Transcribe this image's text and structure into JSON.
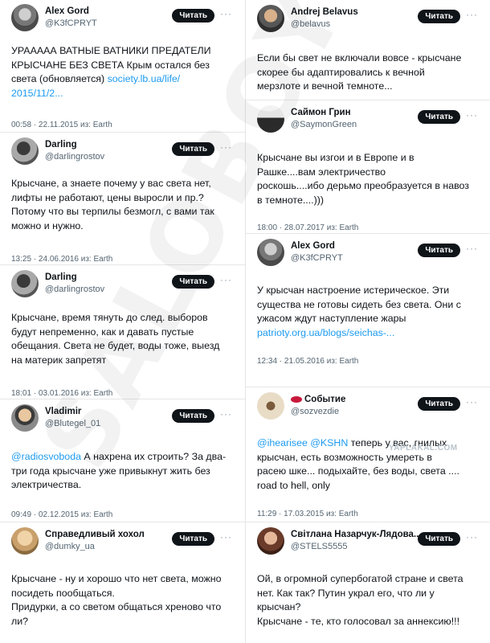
{
  "ui": {
    "follow_label": "Читать",
    "more_glyph": "···"
  },
  "watermark": "SALOBOY",
  "site_watermark": "YAPLAKAL.COM",
  "left": [
    {
      "name": "Alex Gord",
      "handle": "@K3fCPRYT",
      "lines": [
        [
          "УРААААА ВАТНЫЕ ВАТНИКИ ПРЕДАТЕЛИ"
        ],
        [
          "КРЫСЧАНЕ БЕЗ СВЕТА  Крым остался без"
        ],
        [
          "света (обновляется) ",
          "society.lb.ua/life/"
        ],
        [
          "",
          "2015/11/2..."
        ]
      ],
      "time": "00:58 · 22.11.2015 из: Earth"
    },
    {
      "name": "Darling",
      "handle": "@darlingrostov",
      "lines": [
        [
          "Крысчане, а знаете почему у вас света нет,"
        ],
        [
          "лифты не работают, цены выросли и пр.?"
        ],
        [
          "Потому что вы терпилы безмогл, с вами так"
        ],
        [
          "можно и нужно."
        ]
      ],
      "time": "13:25 · 24.06.2016 из: Earth"
    },
    {
      "name": "Darling",
      "handle": "@darlingrostov",
      "lines": [
        [
          "Крысчане, время тянуть до след. выборов"
        ],
        [
          "будут непременно, как и давать пустые"
        ],
        [
          "обещания. Света не будет, воды тоже, выезд"
        ],
        [
          "на материк запретят"
        ]
      ],
      "time": "18:01 · 03.01.2016 из: Earth"
    },
    {
      "name": "Vladimir",
      "handle": "@Blutegel_01",
      "lines": [
        [
          "",
          "@radiosvoboda",
          " А нахрена их строить? За два-"
        ],
        [
          "три года крысчане уже привыкнут жить без"
        ],
        [
          "электричества."
        ]
      ],
      "time": "09:49 · 02.12.2015 из: Earth"
    },
    {
      "name": "Справедливый хохол",
      "handle": "@dumky_ua",
      "lines": [
        [
          "Крысчане - ну и хорошо что нет света, можно"
        ],
        [
          "посидеть пообщаться."
        ],
        [
          "Придурки, а со светом общаться хреново что"
        ],
        [
          "ли?"
        ]
      ],
      "time": ""
    }
  ],
  "right": [
    {
      "name": "Andrej Belavus",
      "handle": "@belavus",
      "lines": [
        [
          "Если бы свет не включали вовсе - крысчане"
        ],
        [
          "скорее бы адаптировались к вечной"
        ],
        [
          "мерзлоте и вечной темноте..."
        ]
      ],
      "time": ""
    },
    {
      "name": "Саймон Грин",
      "handle": "@SaymonGreen",
      "lines": [
        [
          "Крысчане вы изгои и в Европе и в"
        ],
        [
          "            Рашке....вам электричество"
        ],
        [
          "роскошь....ибо дерьмо преобразуется в навоз"
        ],
        [
          "в темноте....)))"
        ]
      ],
      "time": "18:00 · 28.07.2017 из: Earth"
    },
    {
      "name": "Alex Gord",
      "handle": "@K3fCPRYT",
      "lines": [
        [
          "У крысчан настроение истерическое. Эти"
        ],
        [
          "существа не готовы сидеть без света. Они с"
        ],
        [
          "ужасом ждут наступление жары"
        ],
        [
          "",
          "patrioty.org.ua/blogs/seichas-..."
        ]
      ],
      "time": "12:34 · 21.05.2016 из: Earth"
    },
    {
      "name": "Событие",
      "handle": "@sozvezdie",
      "lines": [
        [
          "",
          "@ihearisee @KSHN",
          " теперь у вас, гнилых"
        ],
        [
          "крысчан, есть возможность умереть в"
        ],
        [
          "расею шке... подыхайте, без воды, света ...."
        ],
        [
          "road to hell, only"
        ]
      ],
      "time": "11:29 · 17.03.2015 из: Earth"
    },
    {
      "name": "Світлана Назарчук-Лядова...",
      "handle": "@STELS5555",
      "lines": [
        [
          "Ой,  в огромной супербогатой стране и света"
        ],
        [
          "нет. Как так? Путин украл его, что ли у"
        ],
        [
          "крысчан?"
        ],
        [
          "Крысчане - те, кто голосовал за аннексию!!!"
        ]
      ],
      "time": ""
    }
  ],
  "colors": {
    "link": "#1d9bf0",
    "follow_bg": "#0f1419",
    "muted": "#536471"
  }
}
